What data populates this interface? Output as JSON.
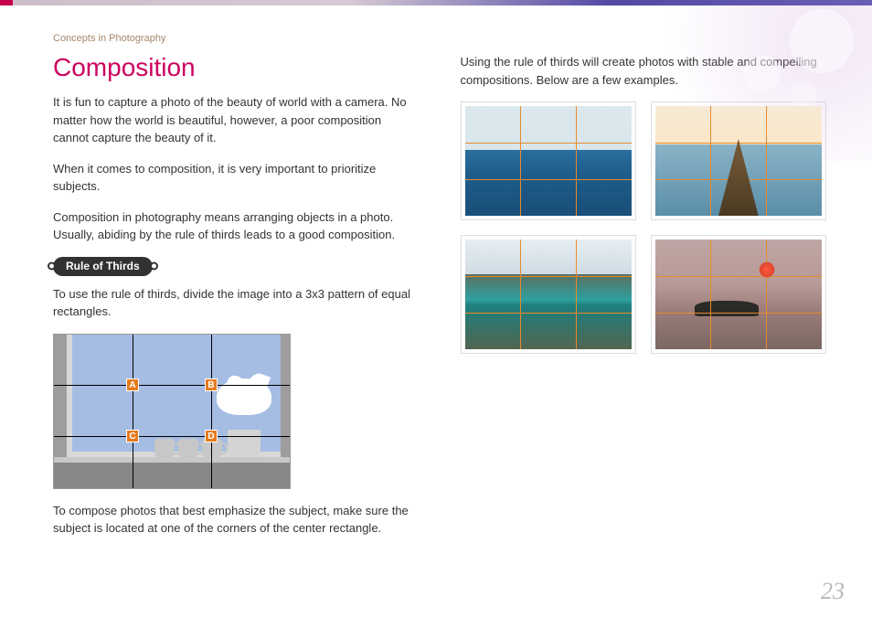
{
  "breadcrumb": "Concepts in Photography",
  "title": "Composition",
  "left": {
    "p1": "It is fun to capture a photo of the beauty of world with a camera. No matter how the world is beautiful, however, a poor composition cannot capture the beauty of it.",
    "p2": "When it comes to composition, it is very important to prioritize subjects.",
    "p3": "Composition in photography means arranging objects in a photo. Usually, abiding by the rule of thirds leads to a good composition.",
    "pill": "Rule of Thirds",
    "p4": "To use the rule of thirds, divide the image into a 3x3 pattern of equal rectangles.",
    "labels": {
      "a": "A",
      "b": "B",
      "c": "C",
      "d": "D"
    },
    "p5": "To compose photos that best emphasize the subject, make sure the subject is located at one of the corners of the center rectangle."
  },
  "right": {
    "intro": "Using the rule of thirds will create photos with stable and compelling compositions. Below are a few examples."
  },
  "page_number": "23"
}
